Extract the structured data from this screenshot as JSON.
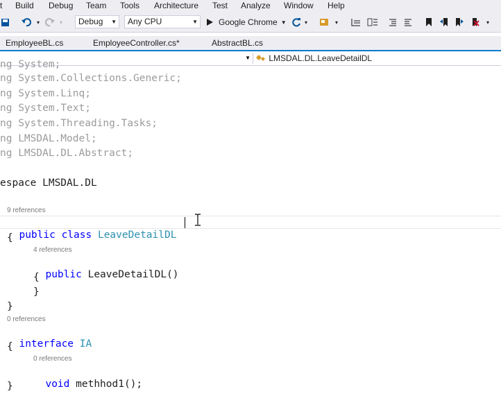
{
  "menu": {
    "items": [
      "t",
      "Build",
      "Debug",
      "Team",
      "Tools",
      "Architecture",
      "Test",
      "Analyze",
      "Window",
      "Help"
    ]
  },
  "toolbar": {
    "config_value": "Debug",
    "platform_value": "Any CPU",
    "run_target_label": "Google Chrome"
  },
  "tabs": [
    {
      "label": "EmployeeBL.cs",
      "active": false
    },
    {
      "label": "EmployeeController.cs*",
      "active": false
    },
    {
      "label": "AbstractBL.cs",
      "active": false
    }
  ],
  "navigation": {
    "member_path": "LMSDAL.DL.LeaveDetailDL"
  },
  "code": {
    "lines": [
      {
        "text": "ng System;"
      },
      {
        "text": "ng System.Collections.Generic;"
      },
      {
        "text": "ng System.Linq;"
      },
      {
        "text": "ng System.Text;"
      },
      {
        "text": "ng System.Threading.Tasks;"
      },
      {
        "text": "ng LMSDAL.Model;"
      },
      {
        "text": "ng LMSDAL.DL.Abstract;"
      },
      {
        "text": "espace LMSDAL.DL"
      }
    ],
    "ref_class": "9 references",
    "class_kw": "public class",
    "class_name": "LeaveDetailDL",
    "open_brace_1": "{",
    "ref_ctor": "4 references",
    "ctor_kw": "public",
    "ctor_name": "LeaveDetailDL()",
    "open_brace_2": "{",
    "close_brace_2": "}",
    "close_brace_1": "}",
    "ref_interface": "0 references",
    "interface_kw": "interface",
    "interface_name": "IA",
    "open_brace_3": "{",
    "ref_method": "0 references",
    "method_kw": "void",
    "method_sig": "methhod1();",
    "close_brace_3": "}"
  },
  "colors": {
    "accent": "#007acc",
    "keyword": "#0000ff",
    "type": "#2b91af",
    "using_grey": "#9b9b9b"
  }
}
